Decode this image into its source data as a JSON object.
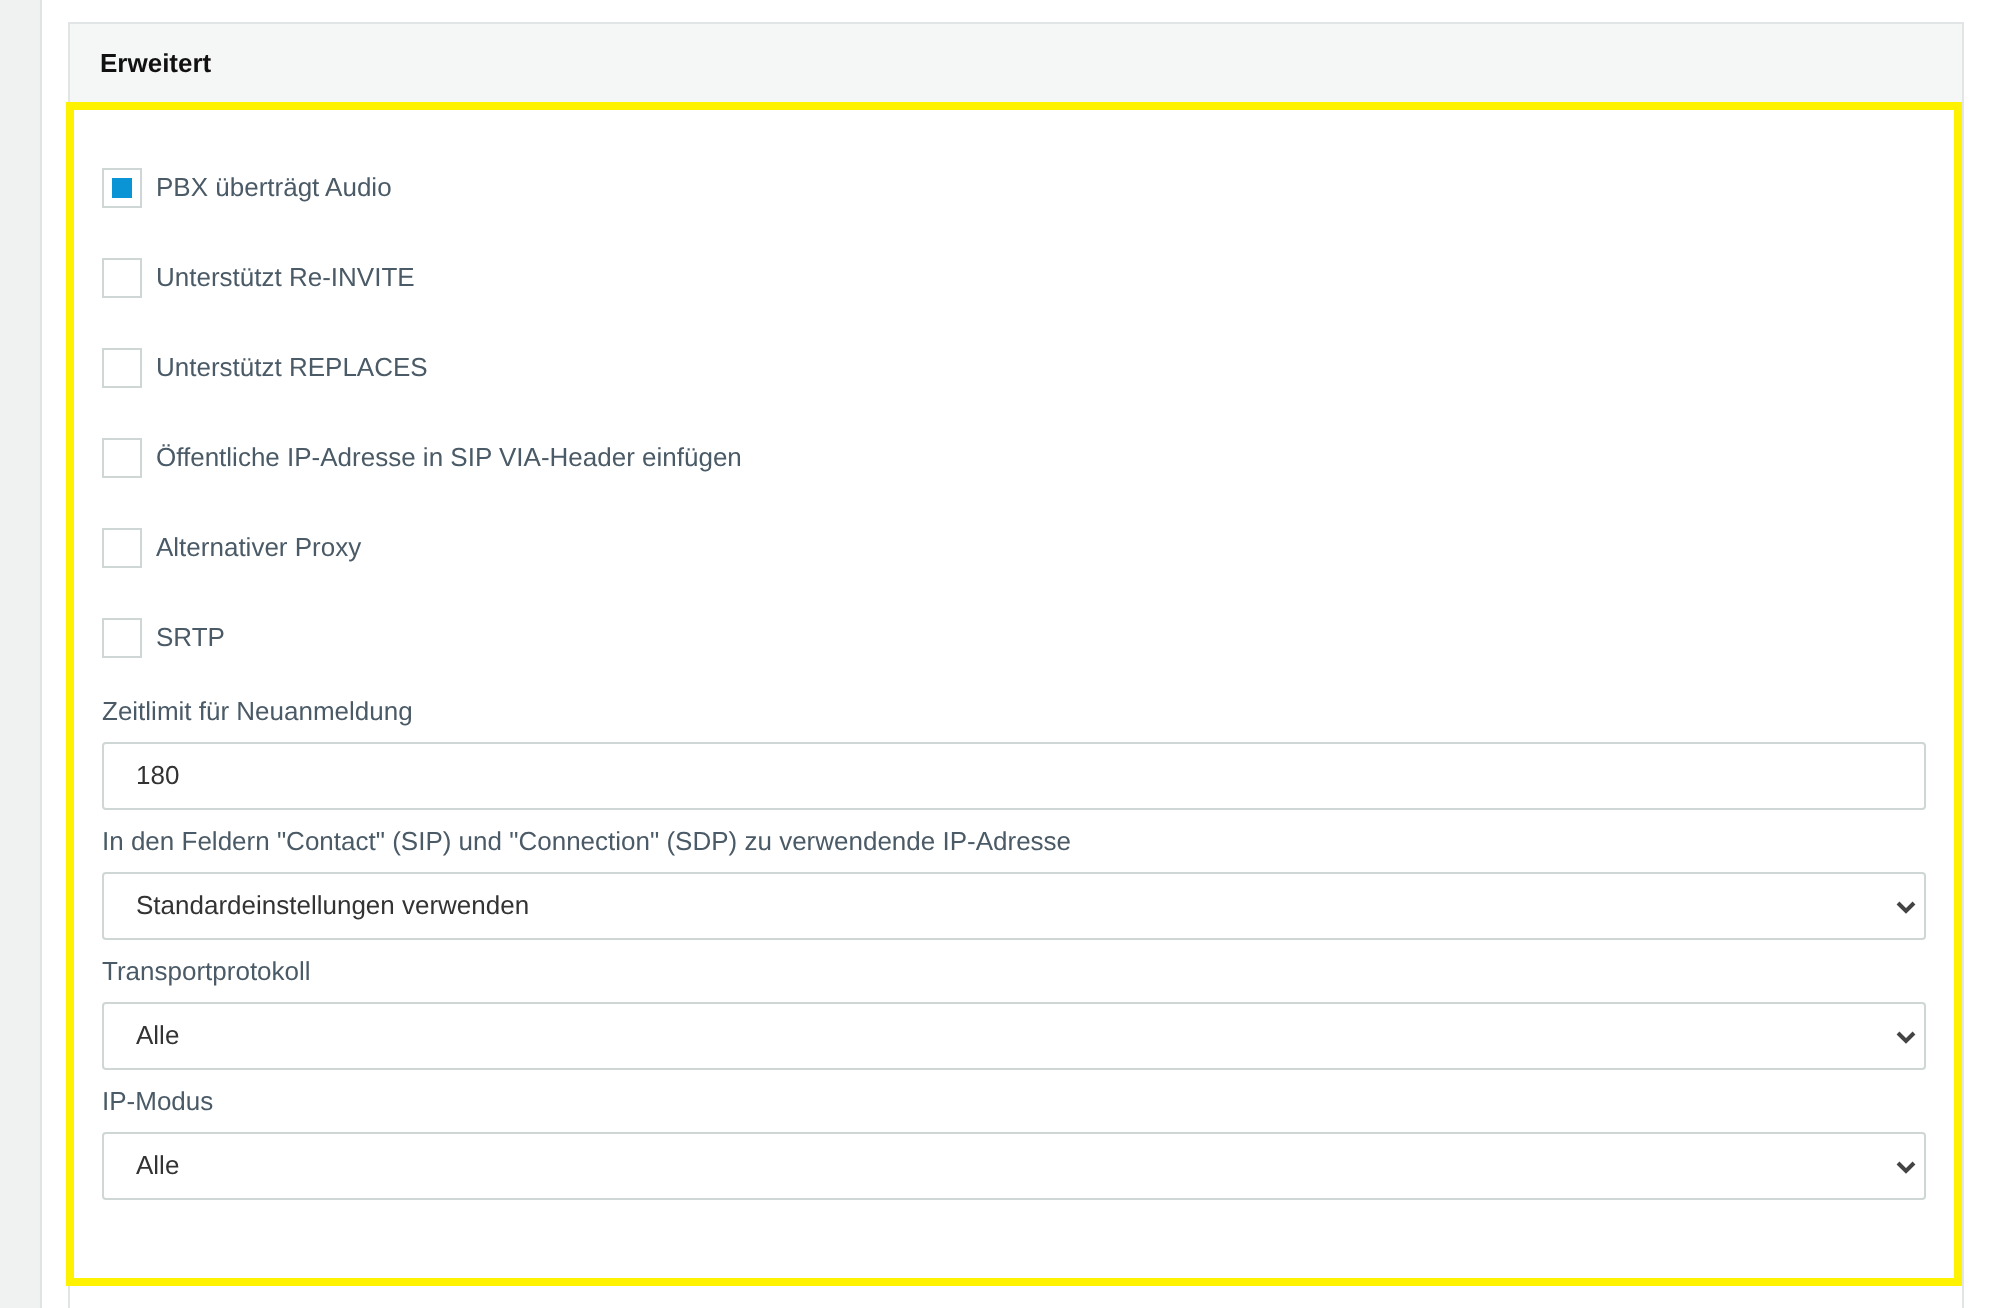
{
  "panel": {
    "title": "Erweitert"
  },
  "fields": [
    {
      "kind": "checkbox",
      "label": "PBX überträgt Audio",
      "checked": true
    },
    {
      "kind": "checkbox",
      "label": "Unterstützt Re-INVITE",
      "checked": false
    },
    {
      "kind": "checkbox",
      "label": "Unterstützt REPLACES",
      "checked": false
    },
    {
      "kind": "checkbox",
      "label": "Öffentliche IP-Adresse in SIP VIA-Header einfügen",
      "checked": false
    },
    {
      "kind": "checkbox",
      "label": "Alternativer Proxy",
      "checked": false
    },
    {
      "kind": "checkbox",
      "label": "SRTP",
      "checked": false
    },
    {
      "kind": "text",
      "label": "Zeitlimit für Neuanmeldung",
      "value": "180"
    },
    {
      "kind": "select",
      "label": "In den Feldern \"Contact\" (SIP) und \"Connection\" (SDP) zu verwendende IP-Adresse",
      "value": "Standardeinstellungen verwenden"
    },
    {
      "kind": "select",
      "label": "Transportprotokoll",
      "value": "Alle"
    },
    {
      "kind": "select",
      "label": "IP-Modus",
      "value": "Alle"
    }
  ]
}
